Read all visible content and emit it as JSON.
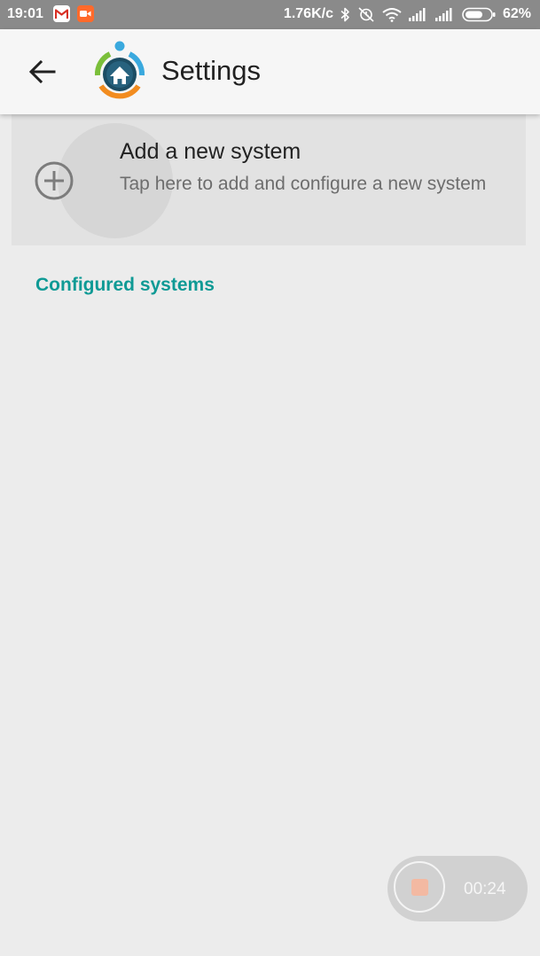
{
  "status_bar": {
    "time": "19:01",
    "network_speed": "1.76K/c",
    "battery": "62%",
    "icons": [
      "gmail-icon",
      "screen-recorder-icon",
      "bluetooth-icon",
      "alarm-off-icon",
      "wifi-icon",
      "signal-icon",
      "signal-icon",
      "battery-icon"
    ],
    "colors": {
      "bar": "#8a8a8a",
      "recorder": "#ff6a2b",
      "gmail": "#d93025"
    }
  },
  "app_bar": {
    "title": "Settings",
    "back_icon": "arrow-back-icon",
    "logo": "home-automation-logo"
  },
  "add_system": {
    "title": "Add a new system",
    "subtitle": "Tap here to add and configure a new system",
    "icon": "add-circle-icon"
  },
  "sections": {
    "configured": "Configured systems"
  },
  "recorder": {
    "elapsed": "00:24"
  },
  "colors": {
    "accent": "#0f9a95",
    "background": "#ececec",
    "app_bar": "#f6f6f6"
  }
}
